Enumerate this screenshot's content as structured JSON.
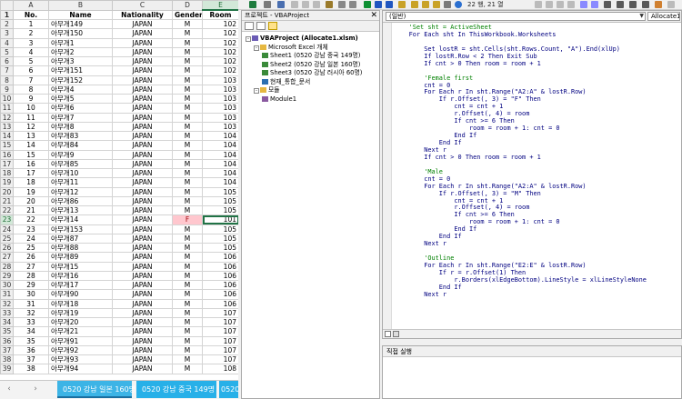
{
  "excel": {
    "columns": [
      "A",
      "B",
      "C",
      "D",
      "E"
    ],
    "headers": [
      "No.",
      "Name",
      "Nationality",
      "Gender",
      "Room"
    ],
    "rows": [
      {
        "r": "2",
        "no": "1",
        "name": "아무개149",
        "nat": "JAPAN",
        "gen": "M",
        "room": "102"
      },
      {
        "r": "3",
        "no": "2",
        "name": "아무개150",
        "nat": "JAPAN",
        "gen": "M",
        "room": "102"
      },
      {
        "r": "4",
        "no": "3",
        "name": "아무개1",
        "nat": "JAPAN",
        "gen": "M",
        "room": "102"
      },
      {
        "r": "5",
        "no": "4",
        "name": "아무개2",
        "nat": "JAPAN",
        "gen": "M",
        "room": "102"
      },
      {
        "r": "6",
        "no": "5",
        "name": "아무개3",
        "nat": "JAPAN",
        "gen": "M",
        "room": "102"
      },
      {
        "r": "7",
        "no": "6",
        "name": "아무개151",
        "nat": "JAPAN",
        "gen": "M",
        "room": "102"
      },
      {
        "r": "8",
        "no": "7",
        "name": "아무개152",
        "nat": "JAPAN",
        "gen": "M",
        "room": "103"
      },
      {
        "r": "9",
        "no": "8",
        "name": "아무개4",
        "nat": "JAPAN",
        "gen": "M",
        "room": "103"
      },
      {
        "r": "10",
        "no": "9",
        "name": "아무개5",
        "nat": "JAPAN",
        "gen": "M",
        "room": "103"
      },
      {
        "r": "11",
        "no": "10",
        "name": "아무개6",
        "nat": "JAPAN",
        "gen": "M",
        "room": "103"
      },
      {
        "r": "12",
        "no": "11",
        "name": "아무개7",
        "nat": "JAPAN",
        "gen": "M",
        "room": "103"
      },
      {
        "r": "13",
        "no": "12",
        "name": "아무개8",
        "nat": "JAPAN",
        "gen": "M",
        "room": "103"
      },
      {
        "r": "14",
        "no": "13",
        "name": "아무개83",
        "nat": "JAPAN",
        "gen": "M",
        "room": "104"
      },
      {
        "r": "15",
        "no": "14",
        "name": "아무개84",
        "nat": "JAPAN",
        "gen": "M",
        "room": "104"
      },
      {
        "r": "16",
        "no": "15",
        "name": "아무개9",
        "nat": "JAPAN",
        "gen": "M",
        "room": "104"
      },
      {
        "r": "17",
        "no": "16",
        "name": "아무개85",
        "nat": "JAPAN",
        "gen": "M",
        "room": "104"
      },
      {
        "r": "18",
        "no": "17",
        "name": "아무개10",
        "nat": "JAPAN",
        "gen": "M",
        "room": "104"
      },
      {
        "r": "19",
        "no": "18",
        "name": "아무개11",
        "nat": "JAPAN",
        "gen": "M",
        "room": "104"
      },
      {
        "r": "20",
        "no": "19",
        "name": "아무개12",
        "nat": "JAPAN",
        "gen": "M",
        "room": "105"
      },
      {
        "r": "21",
        "no": "20",
        "name": "아무개86",
        "nat": "JAPAN",
        "gen": "M",
        "room": "105"
      },
      {
        "r": "22",
        "no": "21",
        "name": "아무개13",
        "nat": "JAPAN",
        "gen": "M",
        "room": "105"
      },
      {
        "r": "23",
        "no": "22",
        "name": "아무개14",
        "nat": "JAPAN",
        "gen": "F",
        "room": "101",
        "female": true
      },
      {
        "r": "24",
        "no": "23",
        "name": "아무개153",
        "nat": "JAPAN",
        "gen": "M",
        "room": "105"
      },
      {
        "r": "25",
        "no": "24",
        "name": "아무개87",
        "nat": "JAPAN",
        "gen": "M",
        "room": "105"
      },
      {
        "r": "26",
        "no": "25",
        "name": "아무개88",
        "nat": "JAPAN",
        "gen": "M",
        "room": "105"
      },
      {
        "r": "27",
        "no": "26",
        "name": "아무개89",
        "nat": "JAPAN",
        "gen": "M",
        "room": "106"
      },
      {
        "r": "28",
        "no": "27",
        "name": "아무개15",
        "nat": "JAPAN",
        "gen": "M",
        "room": "106"
      },
      {
        "r": "29",
        "no": "28",
        "name": "아무개16",
        "nat": "JAPAN",
        "gen": "M",
        "room": "106"
      },
      {
        "r": "30",
        "no": "29",
        "name": "아무개17",
        "nat": "JAPAN",
        "gen": "M",
        "room": "106"
      },
      {
        "r": "31",
        "no": "30",
        "name": "아무개90",
        "nat": "JAPAN",
        "gen": "M",
        "room": "106"
      },
      {
        "r": "32",
        "no": "31",
        "name": "아무개18",
        "nat": "JAPAN",
        "gen": "M",
        "room": "106"
      },
      {
        "r": "33",
        "no": "32",
        "name": "아무개19",
        "nat": "JAPAN",
        "gen": "M",
        "room": "107"
      },
      {
        "r": "34",
        "no": "33",
        "name": "아무개20",
        "nat": "JAPAN",
        "gen": "M",
        "room": "107"
      },
      {
        "r": "35",
        "no": "34",
        "name": "아무개21",
        "nat": "JAPAN",
        "gen": "M",
        "room": "107"
      },
      {
        "r": "36",
        "no": "35",
        "name": "아무개91",
        "nat": "JAPAN",
        "gen": "M",
        "room": "107"
      },
      {
        "r": "37",
        "no": "36",
        "name": "아무개92",
        "nat": "JAPAN",
        "gen": "M",
        "room": "107"
      },
      {
        "r": "38",
        "no": "37",
        "name": "아무개93",
        "nat": "JAPAN",
        "gen": "M",
        "room": "107"
      },
      {
        "r": "39",
        "no": "38",
        "name": "아무개94",
        "nat": "JAPAN",
        "gen": "M",
        "room": "108"
      }
    ],
    "tabs": [
      "0520 강남 일본 160명",
      "0520 강남 중국 149명",
      "0520"
    ],
    "colors": {
      "accent": "#217346",
      "tab_blue": "#27b0e8",
      "female_fill": "#ffc7ce"
    }
  },
  "vbe": {
    "toolbar_position": "22 행, 21 열",
    "project_title": "프로젝트 - VBAProject",
    "tree": [
      {
        "label": "VBAProject (Allocate1.xlsm)",
        "level": 0,
        "icon": "project-icon",
        "bold": true,
        "pm": "-"
      },
      {
        "label": "Microsoft Excel 개체",
        "level": 1,
        "icon": "folder-icon",
        "pm": "-"
      },
      {
        "label": "Sheet1 (0520 강남 중국 149명)",
        "level": 2,
        "icon": "sheet-icon"
      },
      {
        "label": "Sheet2 (0520 강남 일본 160명)",
        "level": 2,
        "icon": "sheet-icon"
      },
      {
        "label": "Sheet3 (0520 강남 러시아 60명)",
        "level": 2,
        "icon": "sheet-icon"
      },
      {
        "label": "현재_통합_문서",
        "level": 2,
        "icon": "workbook-icon"
      },
      {
        "label": "모듈",
        "level": 1,
        "icon": "folder-icon",
        "pm": "-"
      },
      {
        "label": "Module1",
        "level": 2,
        "icon": "module-icon"
      }
    ],
    "code_combo_left": "(일반)",
    "code_combo_right": "Allocate1",
    "code_lines": [
      "    'Set sht = ActiveSheet",
      "    For Each sht In ThisWorkbook.Worksheets",
      "",
      "        Set lostR = sht.Cells(sht.Rows.Count, \"A\").End(xlUp)",
      "        If lostR.Row < 2 Then Exit Sub",
      "        If cnt > 0 Then room = room + 1",
      "",
      "        'Female first",
      "        cnt = 0",
      "        For Each r In sht.Range(\"A2:A\" & lostR.Row)",
      "            If r.Offset(, 3) = \"F\" Then",
      "                cnt = cnt + 1",
      "                r.Offset(, 4) = room",
      "                If cnt >= 6 Then",
      "                    room = room + 1: cnt = 0",
      "                End If",
      "            End If",
      "        Next r",
      "        If cnt > 0 Then room = room + 1",
      "",
      "        'Male",
      "        cnt = 0",
      "        For Each r In sht.Range(\"A2:A\" & lostR.Row)",
      "            If r.Offset(, 3) = \"M\" Then",
      "                cnt = cnt + 1",
      "                r.Offset(, 4) = room",
      "                If cnt >= 6 Then",
      "                    room = room + 1: cnt = 0",
      "                End If",
      "            End If",
      "        Next r",
      "",
      "        'Outline",
      "        For Each r In sht.Range(\"E2:E\" & lostR.Row)",
      "            If r = r.Offset(1) Then",
      "                r.Borders(xlEdgeBottom).LineStyle = xlLineStyleNone",
      "            End If",
      "        Next r",
      "",
      "",
      "",
      ""
    ],
    "immediate_title": "직접 실행"
  }
}
